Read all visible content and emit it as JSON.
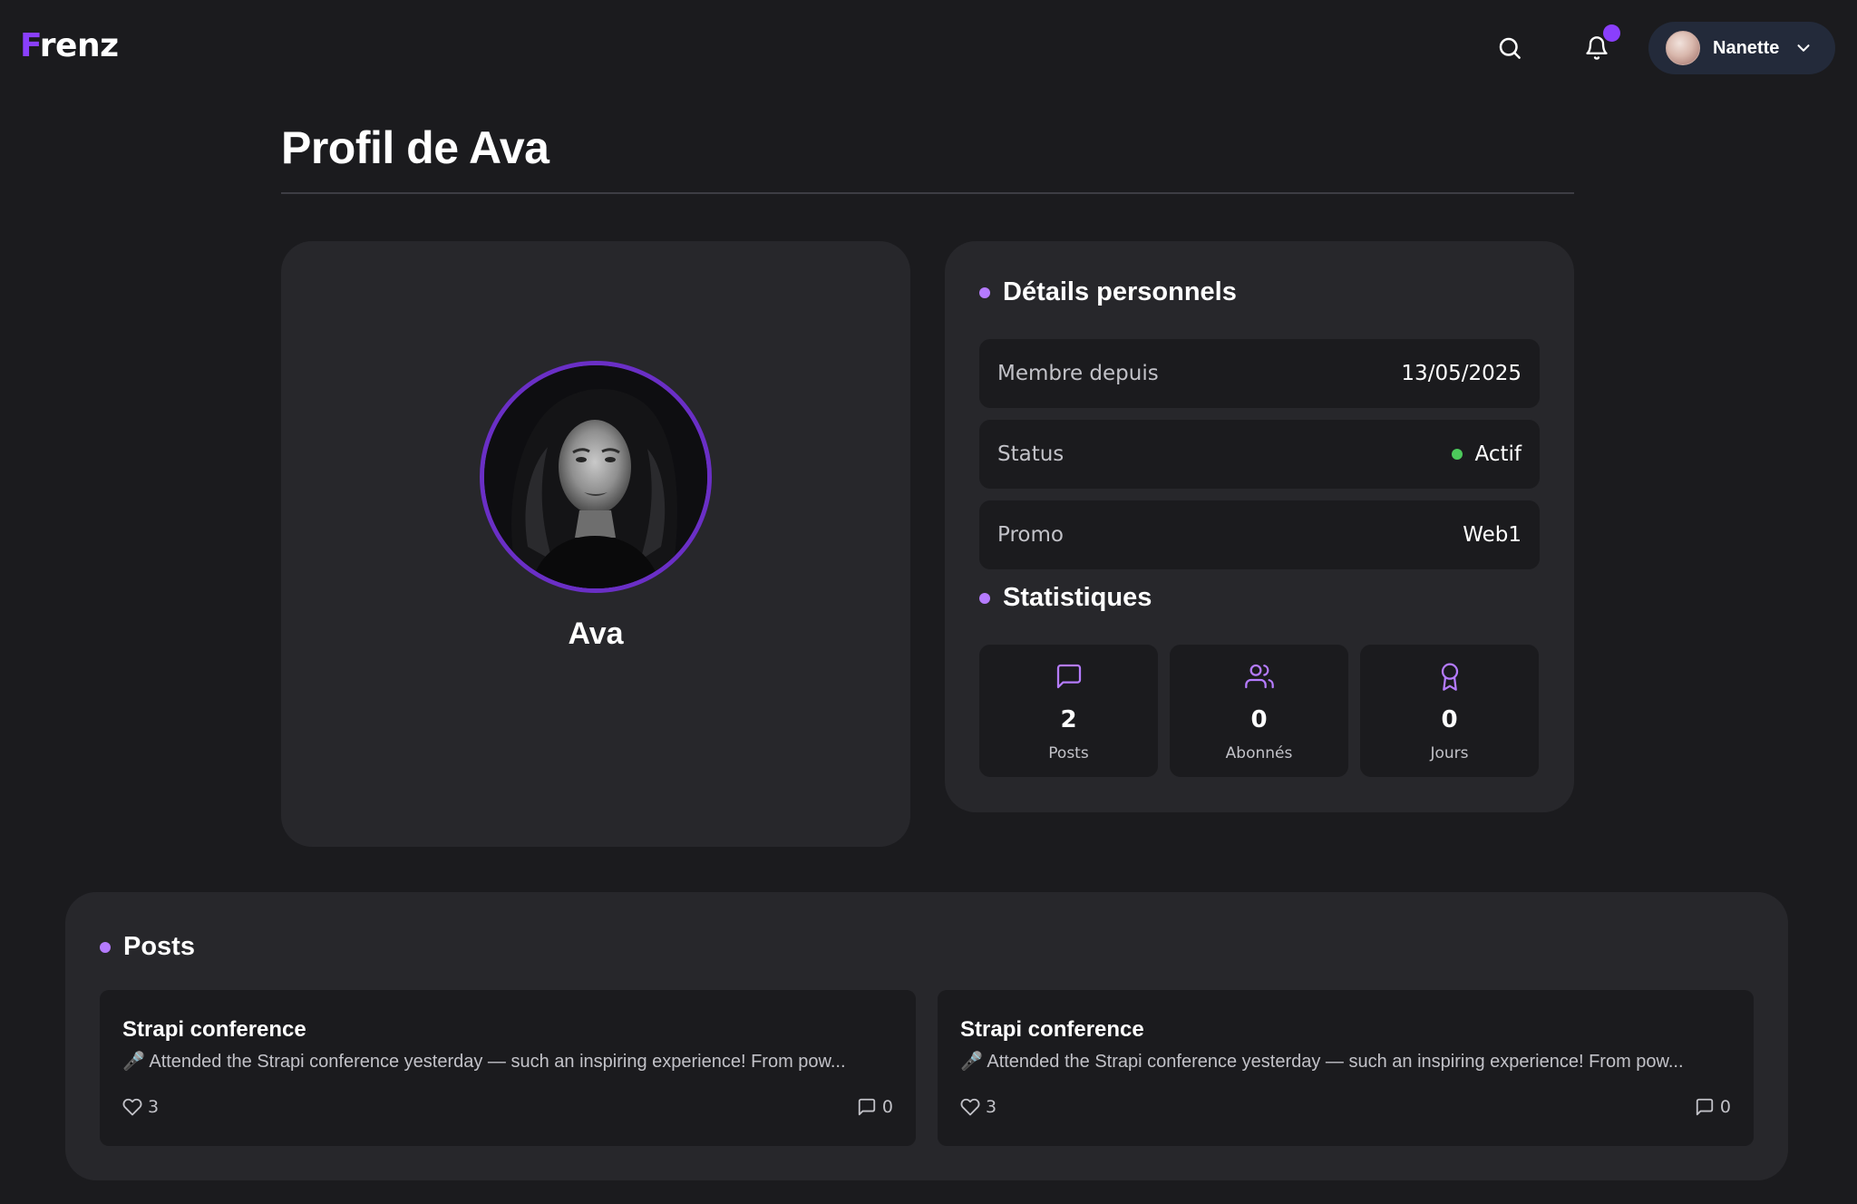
{
  "header": {
    "logo_first": "F",
    "logo_rest": "renz",
    "search_icon": "search-icon",
    "notification_icon": "bell-icon",
    "has_unread_notification": true,
    "user": {
      "name": "Nanette",
      "chevron_icon": "chevron-down-icon"
    }
  },
  "page": {
    "title": "Profil de Ava"
  },
  "profile": {
    "name": "Ava"
  },
  "details": {
    "heading": "Détails personnels",
    "rows": [
      {
        "label": "Membre depuis",
        "value": "13/05/2025"
      },
      {
        "label": "Status",
        "value": "Actif",
        "status_color": "#4cc95b"
      },
      {
        "label": "Promo",
        "value": "Web1"
      }
    ]
  },
  "stats": {
    "heading": "Statistiques",
    "items": [
      {
        "icon": "message-square-icon",
        "value": "2",
        "label": "Posts"
      },
      {
        "icon": "users-icon",
        "value": "0",
        "label": "Abonnés"
      },
      {
        "icon": "award-icon",
        "value": "0",
        "label": "Jours"
      }
    ]
  },
  "posts": {
    "heading": "Posts",
    "items": [
      {
        "title": "Strapi conference",
        "excerpt": "🎤 Attended the Strapi conference yesterday — such an inspiring experience! From pow...",
        "likes": "3",
        "comments": "0"
      },
      {
        "title": "Strapi conference",
        "excerpt": "🎤 Attended the Strapi conference yesterday — such an inspiring experience! From pow...",
        "likes": "3",
        "comments": "0"
      }
    ]
  },
  "colors": {
    "background": "#1b1b1e",
    "card": "#27272b",
    "accent": "#8a3ffc",
    "accent_light": "#b57bff",
    "status_active": "#4cc95b"
  }
}
